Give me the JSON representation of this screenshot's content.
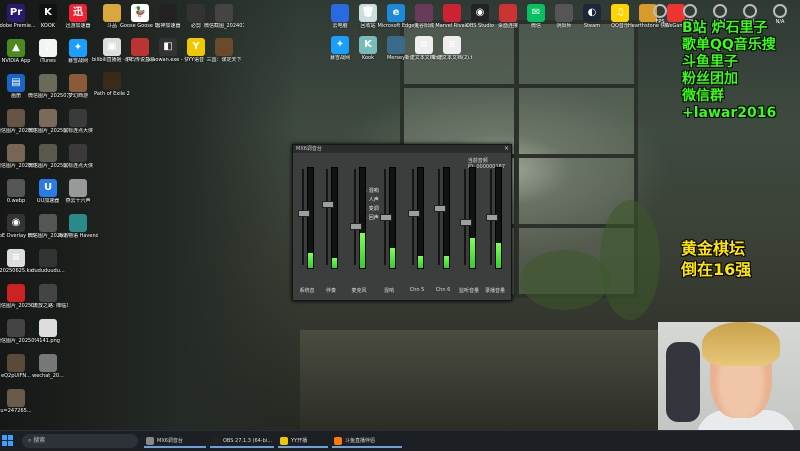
{
  "desktop": {
    "icons_left": [
      {
        "label": "Adobe Premie...",
        "icon": "premiere-icon",
        "color": "#2a1a6e",
        "glyph": "Pr"
      },
      {
        "label": "NVIDIA App",
        "icon": "nvidia-icon",
        "color": "#4a8a1f",
        "glyph": "▲"
      },
      {
        "label": "画册",
        "icon": "album-icon",
        "color": "#1a64c8",
        "glyph": "▤"
      },
      {
        "label": "微信图片_2025050...",
        "icon": "image-file-icon",
        "color": "#665544",
        "glyph": ""
      },
      {
        "label": "微信图片_2025050...",
        "icon": "image-file-icon",
        "color": "#776655",
        "glyph": ""
      },
      {
        "label": "0.webp",
        "icon": "image-file-icon",
        "color": "#555",
        "glyph": ""
      },
      {
        "label": "PoE Overlay II Standal...",
        "icon": "poe-overlay-icon",
        "color": "#333",
        "glyph": "◉"
      },
      {
        "label": "20250625.kx",
        "icon": "kx-file-icon",
        "color": "#ddd",
        "glyph": "≡"
      },
      {
        "label": "微信图片_2025062...",
        "icon": "image-file-icon",
        "color": "#c22",
        "glyph": ""
      },
      {
        "label": "微信图片_2025091...",
        "icon": "image-file-icon",
        "color": "#444",
        "glyph": ""
      },
      {
        "label": "eQ2pUIFN...",
        "icon": "image-file-icon",
        "color": "#5a4a3a",
        "glyph": ""
      },
      {
        "label": "u=247265...",
        "icon": "image-file-icon",
        "color": "#6a5a4a",
        "glyph": ""
      }
    ],
    "icons_col2": [
      {
        "label": "KOOK",
        "icon": "kook-icon",
        "color": "#111",
        "glyph": "K"
      },
      {
        "label": "iTunes",
        "icon": "itunes-icon",
        "color": "#f4f4f4",
        "glyph": "♪"
      },
      {
        "label": "微信图片_2025072...",
        "icon": "image-file-icon",
        "color": "#6a6a5a",
        "glyph": ""
      },
      {
        "label": "微信图片_2025072...",
        "icon": "image-file-icon",
        "color": "#7a6a5a",
        "glyph": ""
      },
      {
        "label": "微信图片_2025072...",
        "icon": "image-file-icon",
        "color": "#5a5a4a",
        "glyph": ""
      },
      {
        "label": "UU加速器",
        "icon": "uu-icon",
        "color": "#2a7be4",
        "glyph": "U"
      },
      {
        "label": "微信图片_2025073...",
        "icon": "image-file-icon",
        "color": "#555",
        "glyph": ""
      },
      {
        "label": "dududuudu...",
        "icon": "image-file-icon",
        "color": "#333",
        "glyph": ""
      },
      {
        "label": "《流放之路: 降临》资光...",
        "icon": "image-file-icon",
        "color": "#444",
        "glyph": ""
      },
      {
        "label": "4141.png",
        "icon": "image-file-icon",
        "color": "#ddd",
        "glyph": ""
      },
      {
        "label": "wechat_20...",
        "icon": "image-file-icon",
        "color": "#777",
        "glyph": ""
      }
    ],
    "icons_col3": [
      {
        "label": "迅游加速器",
        "icon": "xunyou-icon",
        "color": "#e23",
        "glyph": "迅"
      },
      {
        "label": "暴雪战网",
        "icon": "battlenet-icon",
        "color": "#1a9fff",
        "glyph": "✦"
      },
      {
        "label": "梦幻西游",
        "icon": "game-icon",
        "color": "#8a5a3a",
        "glyph": ""
      },
      {
        "label": "鼠标连点大侠",
        "icon": "mouse-clicker-icon",
        "color": "#3a3a3a",
        "glyph": ""
      },
      {
        "label": "鼠标连点大侠",
        "icon": "mouse-clicker-icon",
        "color": "#3a3a3a",
        "glyph": ""
      },
      {
        "label": "燕云十六声",
        "icon": "game-icon",
        "color": "#999",
        "glyph": ""
      },
      {
        "label": "海道物语 Havendock",
        "icon": "game-icon",
        "color": "#2a8a8a",
        "glyph": ""
      }
    ],
    "icons_top": [
      {
        "label": "斗品",
        "icon": "folder-icon",
        "color": "#d9a640",
        "glyph": ""
      },
      {
        "label": "Goose Goose Duck",
        "icon": "goose-icon",
        "color": "#fff",
        "glyph": "🦆"
      },
      {
        "label": "雷神加速器",
        "icon": "leishen-icon",
        "color": "#222",
        "glyph": ""
      },
      {
        "label": "必剪",
        "icon": "bijian-icon",
        "color": "#333",
        "glyph": ""
      },
      {
        "label": "微信截图_2024071...",
        "icon": "image-file-icon",
        "color": "#444",
        "glyph": ""
      },
      {
        "label": "bilibili直播姬 - 快捷方式",
        "icon": "bilibili-icon",
        "color": "#ddd",
        "glyph": "▣"
      },
      {
        "label": "炉石传说盒子",
        "icon": "hs-box-icon",
        "color": "#b33",
        "glyph": ""
      },
      {
        "label": "xiaowan.exe - 快捷方式",
        "icon": "exe-icon",
        "color": "#333",
        "glyph": "◧"
      },
      {
        "label": "YY语音",
        "icon": "yy-icon",
        "color": "#f0c800",
        "glyph": "Y"
      },
      {
        "label": "三国：谋定天下",
        "icon": "game-icon",
        "color": "#6a4a2a",
        "glyph": ""
      },
      {
        "label": "Path of Exile 2",
        "icon": "poe2-icon",
        "color": "#3a2a1a",
        "glyph": ""
      },
      {
        "label": "云电脑",
        "icon": "cloud-pc-icon",
        "color": "#2a6ae0",
        "glyph": ""
      },
      {
        "label": "回收站",
        "icon": "recycle-bin-icon",
        "color": "#cdd",
        "glyph": "🗑"
      },
      {
        "label": "Microsoft Edge",
        "icon": "edge-icon",
        "color": "#1c8ad8",
        "glyph": "e"
      },
      {
        "label": "鬼谷阳城",
        "icon": "game-icon",
        "color": "#6a3a5a",
        "glyph": ""
      },
      {
        "label": "Marvel Rivals",
        "icon": "game-icon",
        "color": "#c23",
        "glyph": ""
      },
      {
        "label": "OBS Studio",
        "icon": "obs-icon",
        "color": "#222",
        "glyph": "◉"
      },
      {
        "label": "桌面连接",
        "icon": "game-icon",
        "color": "#c33",
        "glyph": ""
      },
      {
        "label": "微信",
        "icon": "wechat-icon",
        "color": "#07c160",
        "glyph": "✉"
      },
      {
        "label": "阴阳师",
        "icon": "game-icon",
        "color": "#555",
        "glyph": ""
      },
      {
        "label": "Steam",
        "icon": "steam-icon",
        "color": "#1b2838",
        "glyph": "◐"
      },
      {
        "label": "QQ音乐",
        "icon": "qqmusic-icon",
        "color": "#ffd400",
        "glyph": "♫"
      },
      {
        "label": "Hearthstone 快捷方式",
        "icon": "hearthstone-icon",
        "color": "#d89b2a",
        "glyph": ""
      },
      {
        "label": "WeGame",
        "icon": "wegame-icon",
        "color": "#e33",
        "glyph": ""
      },
      {
        "label": "暴雪战网",
        "icon": "battlenet-icon",
        "color": "#1a9fff",
        "glyph": "✦"
      },
      {
        "label": "Kook",
        "icon": "kook-icon",
        "color": "#7bb",
        "glyph": "K"
      },
      {
        "label": "Mersey",
        "icon": "mersey-icon",
        "color": "#3a6a8a",
        "glyph": ""
      },
      {
        "label": "新建文本文档.txt",
        "icon": "text-file-icon",
        "color": "#eee",
        "glyph": "≡"
      },
      {
        "label": "新建文本文档(2).txt",
        "icon": "text-file-icon",
        "color": "#eee",
        "glyph": "≡"
      }
    ],
    "sysmon": [
      {
        "label": "FPS",
        "icon": "fps-icon"
      },
      {
        "label": "GPU",
        "icon": "gpu-icon"
      },
      {
        "label": "CPU",
        "icon": "cpu-icon"
      },
      {
        "label": "刷新",
        "icon": "refresh-icon"
      },
      {
        "label": "N/A",
        "icon": "na-icon"
      }
    ]
  },
  "overlay": {
    "green_lines": [
      "B站 炉石里子",
      "歌单QQ音乐搜",
      "斗鱼里子",
      "粉丝团加",
      "微信群+lawar2016"
    ],
    "yellow_lines": [
      "黄金棋坛",
      "倒在16强"
    ],
    "green_color": "#39ff14",
    "yellow_color": "#ffe600"
  },
  "mixer": {
    "title": "MX6调音台",
    "device_label": "当前音频",
    "device_code": "ID: 000000187",
    "fx_items": [
      "混响",
      "人声",
      "变调",
      "回声"
    ],
    "channels": [
      {
        "label": "系统音",
        "meter": 0.15,
        "fader": 0.55
      },
      {
        "label": "伴奏",
        "meter": 0.1,
        "fader": 0.65
      },
      {
        "label": "麦克风",
        "meter": 0.35,
        "fader": 0.4
      },
      {
        "label": "混响",
        "meter": 0.2,
        "fader": 0.5
      },
      {
        "label": "Chn 5",
        "meter": 0.12,
        "fader": 0.55
      },
      {
        "label": "Chn 6",
        "meter": 0.12,
        "fader": 0.6
      },
      {
        "label": "监听音量",
        "meter": 0.3,
        "fader": 0.45
      },
      {
        "label": "录播音量",
        "meter": 0.25,
        "fader": 0.5
      }
    ]
  },
  "taskbar": {
    "search_placeholder": "搜索",
    "tasks": [
      {
        "label": "MX6调音台",
        "icon": "mixer-app-icon",
        "color": "#888"
      },
      {
        "label": "OBS 27.1.3 (64-bi...",
        "icon": "obs-icon",
        "color": "#222"
      },
      {
        "label": "YY开播",
        "icon": "yy-icon",
        "color": "#f0c800"
      },
      {
        "label": "斗鱼直播伴侣",
        "icon": "douyu-icon",
        "color": "#ff7a00"
      }
    ]
  }
}
